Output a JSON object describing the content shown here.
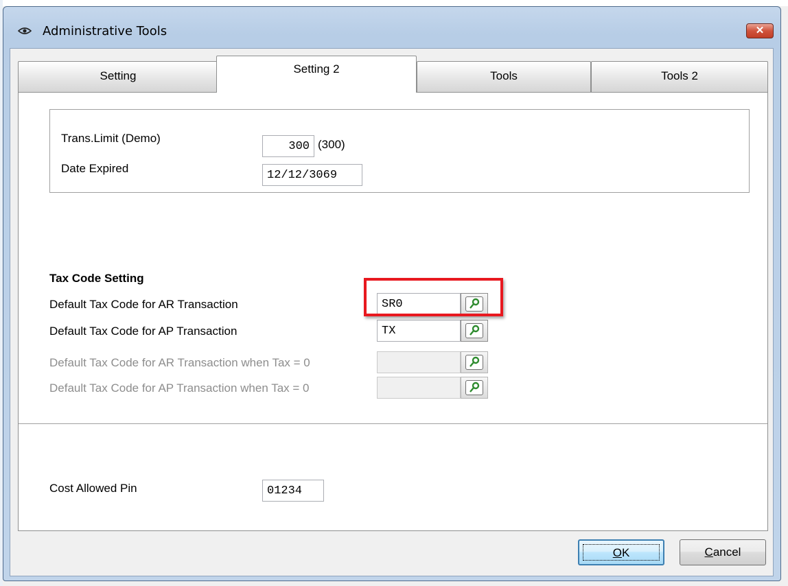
{
  "window": {
    "title": "Administrative Tools",
    "close_label": "✕"
  },
  "tabs": [
    {
      "label": "Setting",
      "active": false
    },
    {
      "label": "Setting 2",
      "active": true
    },
    {
      "label": "Tools",
      "active": false
    },
    {
      "label": "Tools 2",
      "active": false
    }
  ],
  "demo_group": {
    "trans_limit_label": "Trans.Limit (Demo)",
    "trans_limit_value": "300",
    "trans_limit_max": "(300)",
    "date_expired_label": "Date Expired",
    "date_expired_value": "12/12/3069"
  },
  "tax_code": {
    "heading": "Tax Code Setting",
    "ar_label": "Default Tax Code for AR Transaction",
    "ar_value": "SR0",
    "ap_label": "Default Tax Code for AP Transaction",
    "ap_value": "TX",
    "ar_zero_label": "Default Tax Code for AR Transaction when Tax = 0",
    "ar_zero_value": "",
    "ap_zero_label": "Default Tax Code for AP Transaction when Tax = 0",
    "ap_zero_value": ""
  },
  "cost_group": {
    "pin_label": "Cost Allowed Pin",
    "pin_value": "01234"
  },
  "buttons": {
    "ok_accel": "O",
    "ok_rest": "K",
    "cancel_accel": "C",
    "cancel_rest": "ancel"
  },
  "icons": {
    "title": "eye-icon",
    "lookup": "key-icon"
  },
  "colors": {
    "highlight": "#e8181f",
    "lookup_icon": "#2e8b2e"
  }
}
